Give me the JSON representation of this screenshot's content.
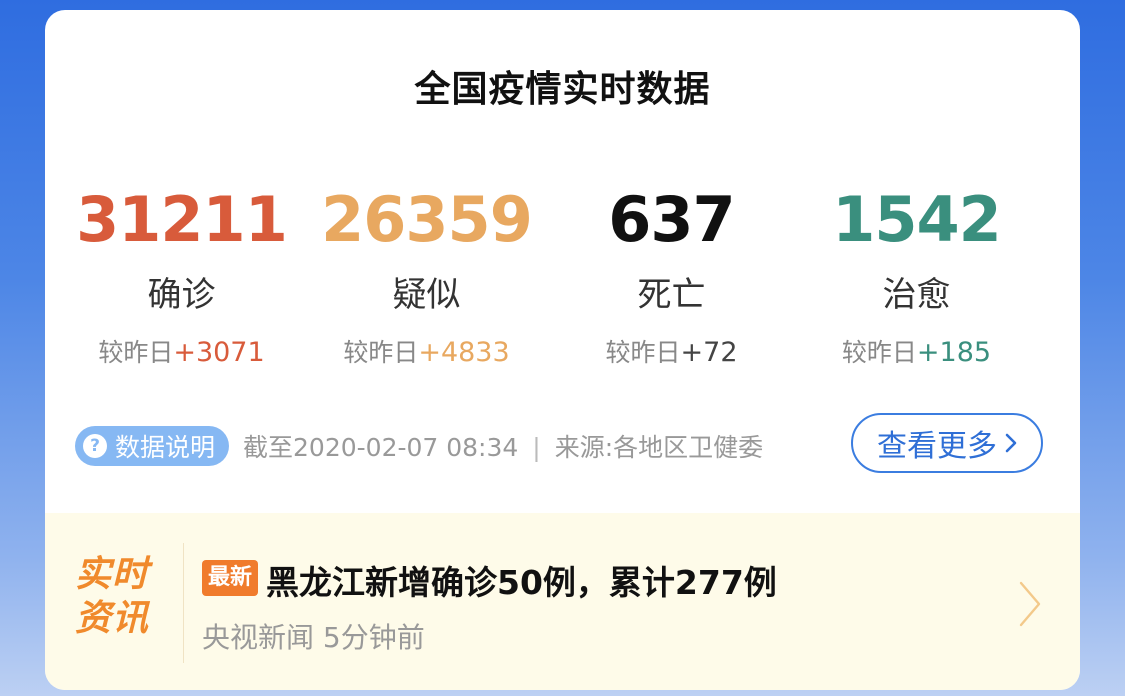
{
  "title": "全国疫情实时数据",
  "stats": [
    {
      "value": "31211",
      "label": "确诊",
      "compare_prefix": "较昨日",
      "delta": "+3071",
      "color": "#d85b3b"
    },
    {
      "value": "26359",
      "label": "疑似",
      "compare_prefix": "较昨日",
      "delta": "+4833",
      "color": "#e8a860"
    },
    {
      "value": "637",
      "label": "死亡",
      "compare_prefix": "较昨日",
      "delta": "+72",
      "color": "#111111"
    },
    {
      "value": "1542",
      "label": "治愈",
      "compare_prefix": "较昨日",
      "delta": "+185",
      "color": "#3a8f7e"
    }
  ],
  "meta": {
    "explain_icon": "question-icon",
    "explain_label": "数据说明",
    "deadline": "截至2020-02-07 08:34",
    "separator": "|",
    "source": "来源:各地区卫健委"
  },
  "more_button": {
    "label": "查看更多",
    "icon": "chevron-right-icon"
  },
  "news": {
    "badge_line1": "实时",
    "badge_line2": "资讯",
    "tag": "最新",
    "headline": "黑龙江新增确诊50例，累计277例",
    "source_time": "央视新闻 5分钟前",
    "chevron_icon": "chevron-right-icon"
  }
}
